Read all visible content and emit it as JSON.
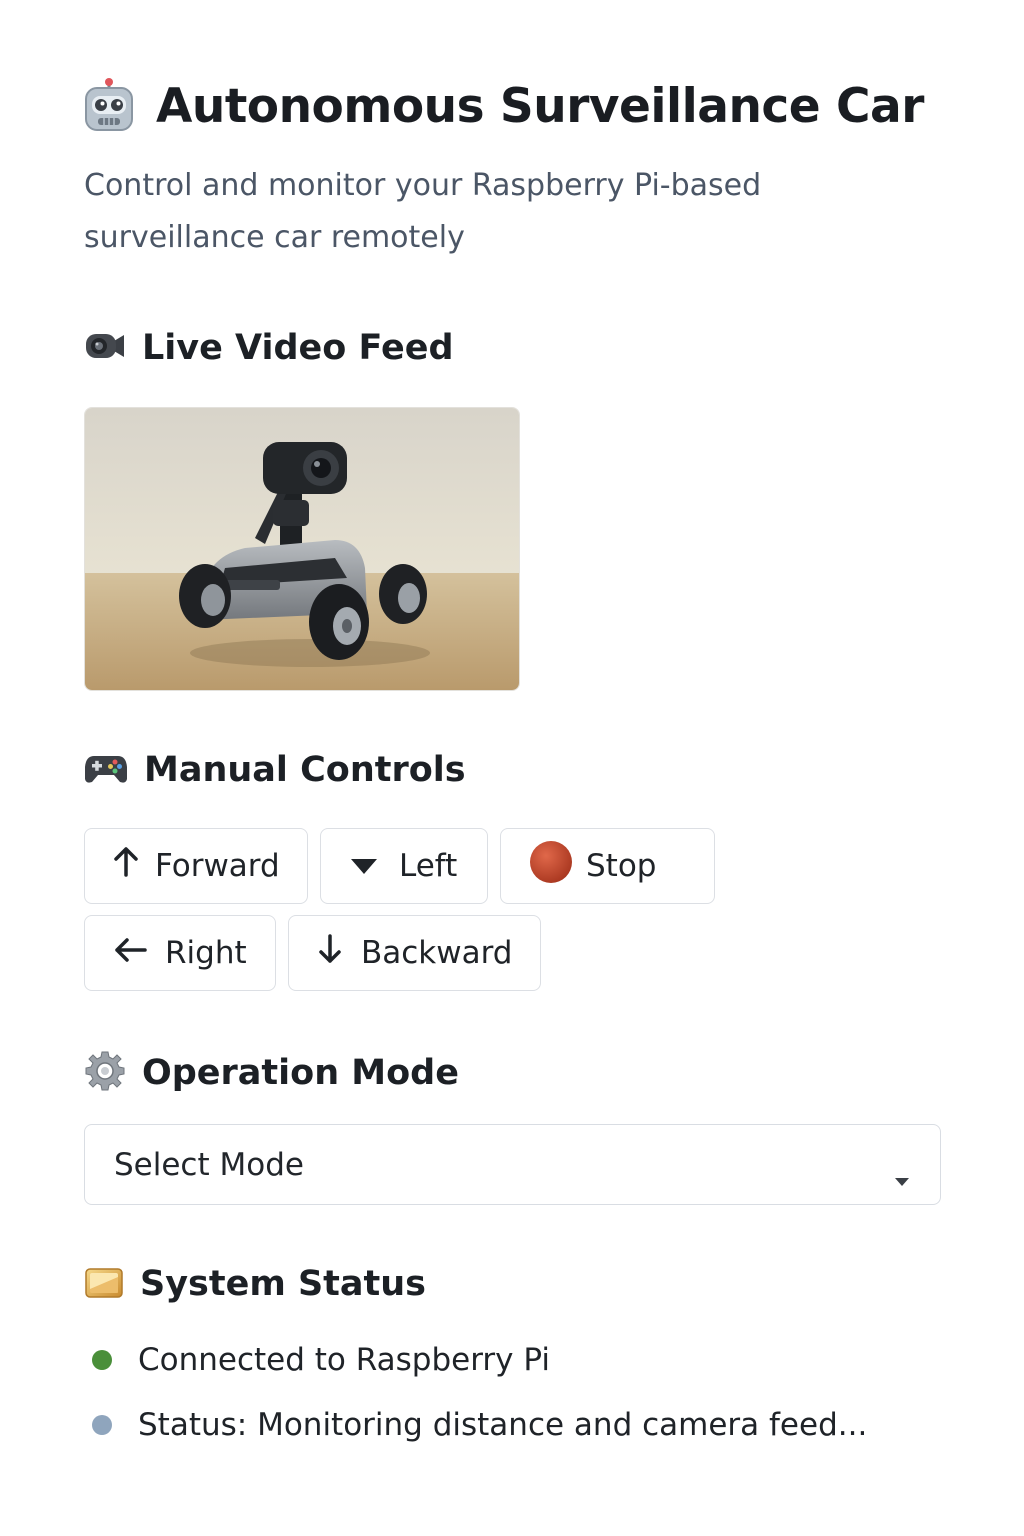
{
  "header": {
    "title": "Autonomous Surveillance Car",
    "title_icon": "robot-face-icon",
    "subtitle": "Control and monitor your Raspberry Pi-based surveillance car remotely"
  },
  "video": {
    "heading": "Live Video Feed",
    "heading_icon": "video-camera-icon",
    "feed_image": "robot-car-with-camera"
  },
  "controls": {
    "heading": "Manual Controls",
    "heading_icon": "game-controller-icon",
    "buttons": [
      {
        "label": "Forward",
        "icon": "arrow-up-icon"
      },
      {
        "label": "Left",
        "icon": "triangle-down-icon"
      },
      {
        "label": "Stop",
        "icon": "red-circle-icon"
      },
      {
        "label": "Right",
        "icon": "arrow-left-icon"
      },
      {
        "label": "Backward",
        "icon": "arrow-down-icon"
      }
    ]
  },
  "mode": {
    "heading": "Operation Mode",
    "heading_icon": "gear-icon",
    "selected": "Select Mode"
  },
  "status": {
    "heading": "System Status",
    "heading_icon": "monitor-icon",
    "items": [
      {
        "text": "Connected to Raspberry Pi",
        "color": "#4a8f3a"
      },
      {
        "text": "Status: Monitoring distance and camera feed...",
        "color": "#8fa5bd"
      }
    ]
  }
}
